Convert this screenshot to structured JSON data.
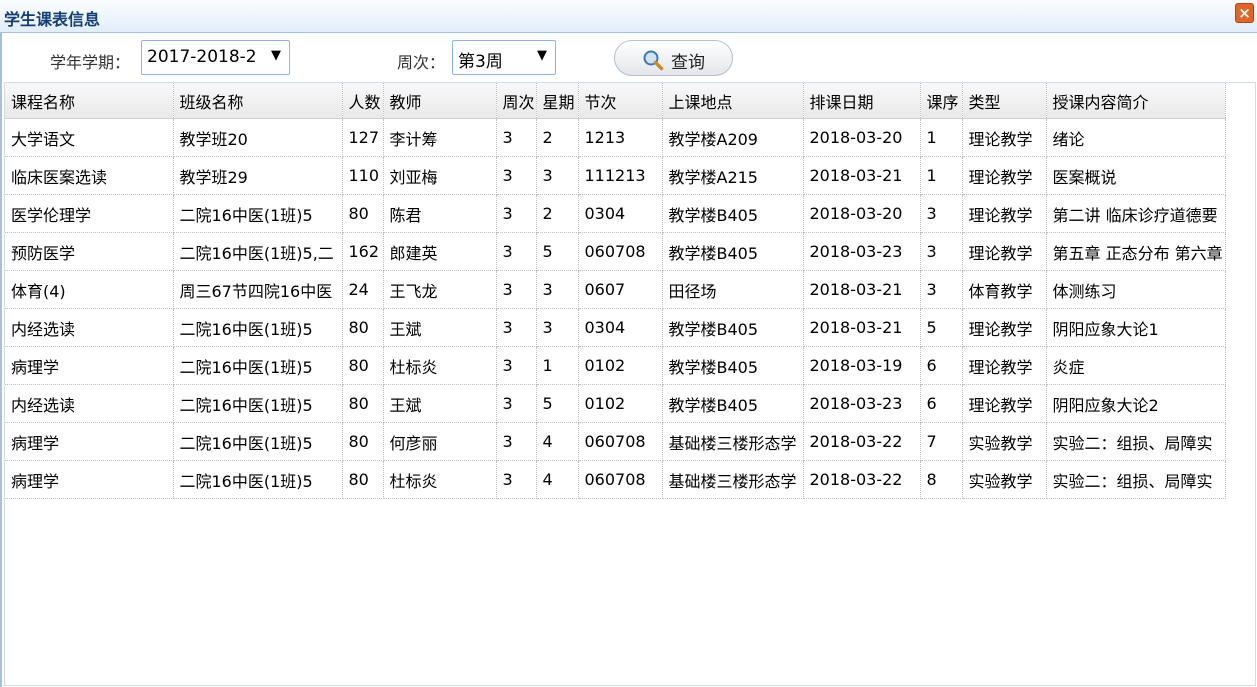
{
  "window": {
    "title": "学生课表信息",
    "close_icon": "close-icon"
  },
  "filters": {
    "term_label": "学年学期：",
    "term_value": "2017-2018-2",
    "week_label": "周次：",
    "week_value": "第3周",
    "dropdown_caret": "▼",
    "search_label": "查询"
  },
  "table": {
    "columns": [
      "课程名称",
      "班级名称",
      "人数",
      "教师",
      "周次",
      "星期",
      "节次",
      "上课地点",
      "排课日期",
      "课序",
      "类型",
      "授课内容简介"
    ],
    "rows": [
      [
        "大学语文",
        "教学班20",
        "127",
        "李计筹",
        "3",
        "2",
        "1213",
        "教学楼A209",
        "2018-03-20",
        "1",
        "理论教学",
        "绪论"
      ],
      [
        "临床医案选读",
        "教学班29",
        "110",
        "刘亚梅",
        "3",
        "3",
        "111213",
        "教学楼A215",
        "2018-03-21",
        "1",
        "理论教学",
        "医案概说"
      ],
      [
        "医学伦理学",
        "二院16中医(1班)5",
        "80",
        "陈君",
        "3",
        "2",
        "0304",
        "教学楼B405",
        "2018-03-20",
        "3",
        "理论教学",
        "第二讲 临床诊疗道德要"
      ],
      [
        "预防医学",
        "二院16中医(1班)5,二",
        "162",
        "郎建英",
        "3",
        "5",
        "060708",
        "教学楼B405",
        "2018-03-23",
        "3",
        "理论教学",
        "第五章 正态分布 第六章"
      ],
      [
        "体育(4)",
        "周三67节四院16中医",
        "24",
        "王飞龙",
        "3",
        "3",
        "0607",
        "田径场",
        "2018-03-21",
        "3",
        "体育教学",
        "体测练习"
      ],
      [
        "内经选读",
        "二院16中医(1班)5",
        "80",
        "王斌",
        "3",
        "3",
        "0304",
        "教学楼B405",
        "2018-03-21",
        "5",
        "理论教学",
        "阴阳应象大论1"
      ],
      [
        "病理学",
        "二院16中医(1班)5",
        "80",
        "杜标炎",
        "3",
        "1",
        "0102",
        "教学楼B405",
        "2018-03-19",
        "6",
        "理论教学",
        "炎症"
      ],
      [
        "内经选读",
        "二院16中医(1班)5",
        "80",
        "王斌",
        "3",
        "5",
        "0102",
        "教学楼B405",
        "2018-03-23",
        "6",
        "理论教学",
        "阴阳应象大论2"
      ],
      [
        "病理学",
        "二院16中医(1班)5",
        "80",
        "何彦丽",
        "3",
        "4",
        "060708",
        "基础楼三楼形态学",
        "2018-03-22",
        "7",
        "实验教学",
        "实验二：组损、局障实"
      ],
      [
        "病理学",
        "二院16中医(1班)5",
        "80",
        "杜标炎",
        "3",
        "4",
        "060708",
        "基础楼三楼形态学",
        "2018-03-22",
        "8",
        "实验教学",
        "实验二：组损、局障实"
      ]
    ]
  },
  "colors": {
    "title": "#123f73",
    "border": "#a6c0de",
    "close": "#e0652c"
  }
}
